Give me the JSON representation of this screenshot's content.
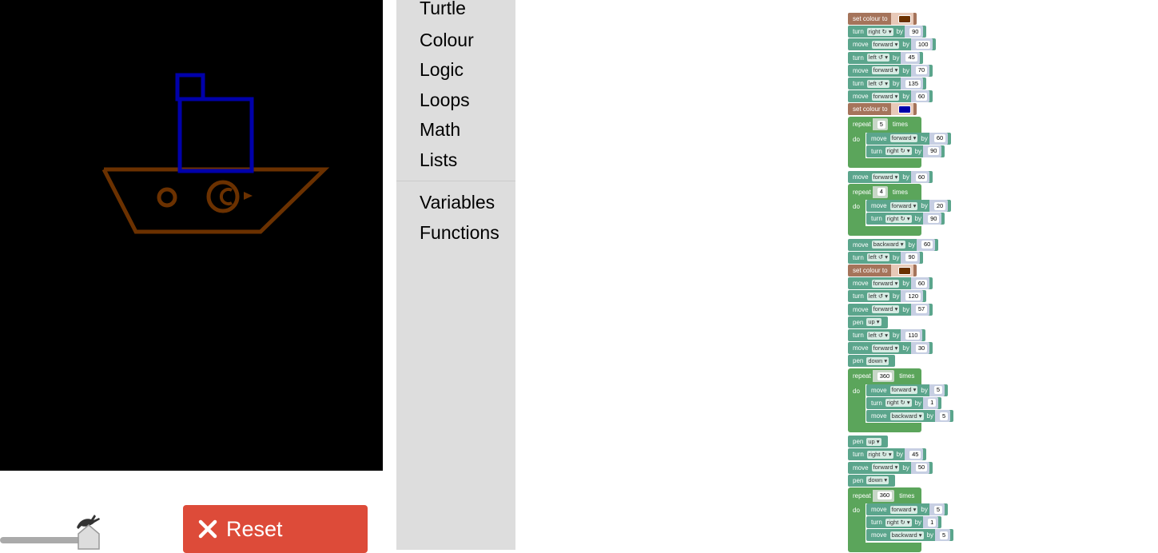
{
  "toolbox": {
    "categories": [
      "Turtle",
      "Colour",
      "Logic",
      "Loops",
      "Math",
      "Lists"
    ],
    "extra": [
      "Variables",
      "Functions"
    ]
  },
  "controls": {
    "reset_label": "Reset"
  },
  "colors": {
    "brown": "#6b3100",
    "blue": "#0000aa",
    "turtle_block": "#5ba58c",
    "loop_block": "#5ba55b",
    "colour_block": "#a5745b",
    "reset": "#dd4b39"
  },
  "words": {
    "set_colour": "set colour to",
    "turn": "turn",
    "move": "move",
    "by": "by",
    "repeat": "repeat",
    "times": "times",
    "do": "do",
    "pen": "pen"
  },
  "program": [
    {
      "t": "colour",
      "color": "#6b3100"
    },
    {
      "t": "turn",
      "dir": "right ↻",
      "v": "90"
    },
    {
      "t": "move",
      "dir": "forward",
      "v": "100"
    },
    {
      "t": "turn",
      "dir": "left ↺",
      "v": "45"
    },
    {
      "t": "move",
      "dir": "forward",
      "v": "70"
    },
    {
      "t": "turn",
      "dir": "left ↺",
      "v": "135"
    },
    {
      "t": "move",
      "dir": "forward",
      "v": "60"
    },
    {
      "t": "colour",
      "color": "#0000aa"
    },
    {
      "t": "repeat",
      "v": "5",
      "body": [
        {
          "t": "move",
          "dir": "forward",
          "v": "60"
        },
        {
          "t": "turn",
          "dir": "right ↻",
          "v": "90"
        }
      ]
    },
    {
      "t": "move",
      "dir": "forward",
      "v": "60"
    },
    {
      "t": "repeat",
      "v": "4",
      "body": [
        {
          "t": "move",
          "dir": "forward",
          "v": "20"
        },
        {
          "t": "turn",
          "dir": "right ↻",
          "v": "90"
        }
      ]
    },
    {
      "t": "move",
      "dir": "backward",
      "v": "60"
    },
    {
      "t": "turn",
      "dir": "left ↺",
      "v": "90"
    },
    {
      "t": "colour",
      "color": "#6b3100"
    },
    {
      "t": "move",
      "dir": "forward",
      "v": "60"
    },
    {
      "t": "turn",
      "dir": "left ↺",
      "v": "120"
    },
    {
      "t": "move",
      "dir": "forward",
      "v": "57"
    },
    {
      "t": "pen",
      "dir": "up"
    },
    {
      "t": "turn",
      "dir": "left ↺",
      "v": "110"
    },
    {
      "t": "move",
      "dir": "forward",
      "v": "30"
    },
    {
      "t": "pen",
      "dir": "down"
    },
    {
      "t": "repeat",
      "v": "360",
      "body": [
        {
          "t": "move",
          "dir": "forward",
          "v": "5"
        },
        {
          "t": "turn",
          "dir": "right ↻",
          "v": "1"
        },
        {
          "t": "move",
          "dir": "backward",
          "v": "5"
        }
      ]
    },
    {
      "t": "pen",
      "dir": "up"
    },
    {
      "t": "turn",
      "dir": "right ↻",
      "v": "45"
    },
    {
      "t": "move",
      "dir": "forward",
      "v": "50"
    },
    {
      "t": "pen",
      "dir": "down"
    },
    {
      "t": "repeat",
      "v": "360",
      "body": [
        {
          "t": "move",
          "dir": "forward",
          "v": "5"
        },
        {
          "t": "turn",
          "dir": "right ↻",
          "v": "1"
        },
        {
          "t": "move",
          "dir": "backward",
          "v": "5"
        }
      ]
    }
  ]
}
